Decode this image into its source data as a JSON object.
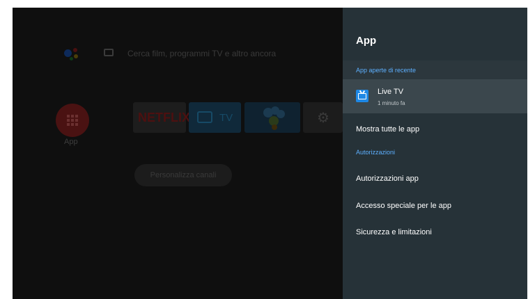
{
  "home": {
    "search_placeholder": "Cerca film, programmi TV e altro ancora",
    "apps_label": "App",
    "netflix_tile_label": "NETFLIX",
    "tv_tile_label": "TV",
    "customize_button": "Personalizza canali"
  },
  "panel": {
    "title": "App",
    "recent_section": "App aperte di recente",
    "recent_apps": [
      {
        "name": "Live TV",
        "subtitle": "1 minuto fa",
        "icon": "live-tv-icon"
      }
    ],
    "show_all": "Mostra tutte le app",
    "permissions_section": "Autorizzazioni",
    "permission_items": [
      "Autorizzazioni app",
      "Accesso speciale per le app",
      "Sicurezza e limitazioni"
    ]
  },
  "colors": {
    "panel_bg": "#263238",
    "section_accent": "#5db0ff",
    "selected_bg": "#3b474d",
    "live_tv_icon": "#1e88e5"
  }
}
